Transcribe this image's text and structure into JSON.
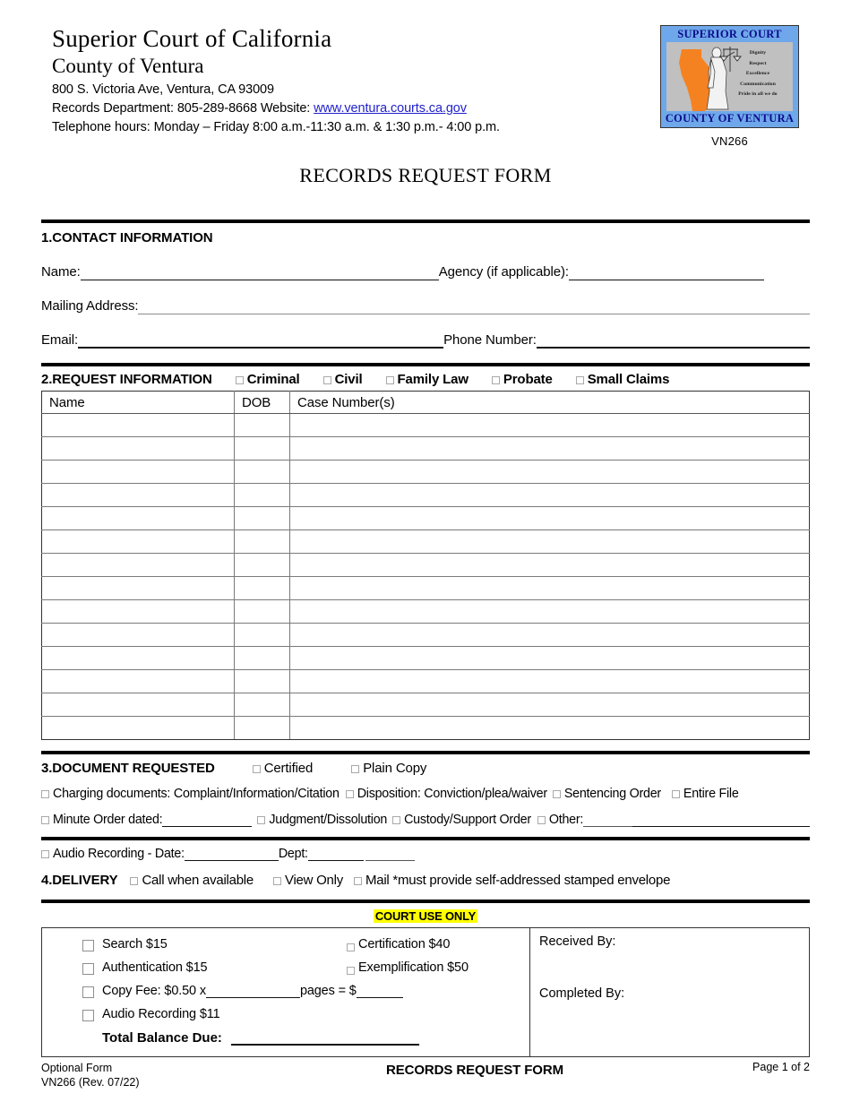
{
  "header": {
    "court_name": "Superior Court of California",
    "county_name": "County of Ventura",
    "address": "800 S. Victoria Ave, Ventura, CA 93009",
    "records_dept_prefix": "Records Department: 805-289-8668  Website: ",
    "website": "www.ventura.courts.ca.gov",
    "telephone_hours": "Telephone hours: Monday – Friday 8:00 a.m.-11:30 a.m. & 1:30 p.m.- 4:00 p.m.",
    "form_code": "VN266"
  },
  "logo": {
    "title": "SUPERIOR COURT",
    "footer": "COUNTY OF VENTURA",
    "values": [
      "Dignity",
      "Respect",
      "Excellence",
      "Communication",
      "Pride in all  we do"
    ],
    "bg_color": "#6fa8ea",
    "inner_color": "#c0c0c0",
    "state_color": "#f58220",
    "text_color": "#0c0c8c"
  },
  "form_title": "RECORDS REQUEST FORM",
  "section1": {
    "heading": "1.CONTACT INFORMATION",
    "name_label": "Name:",
    "agency_label": " Agency (if applicable):",
    "mailing_label": "Mailing Address:",
    "email_label": "Email:",
    "phone_label": "Phone Number:"
  },
  "section2": {
    "heading": "2.REQUEST INFORMATION",
    "categories": [
      "Criminal",
      "Civil",
      "Family Law",
      "Probate",
      "Small Claims"
    ],
    "columns": [
      "Name",
      "DOB",
      "Case Number(s)"
    ],
    "row_count": 14
  },
  "section3": {
    "heading": "3.DOCUMENT REQUESTED",
    "copy_types": [
      "Certified",
      "Plain Copy"
    ],
    "line1": [
      "Charging documents: Complaint/Information/Citation",
      "Disposition: Conviction/plea/waiver",
      "Sentencing Order",
      "Entire File"
    ],
    "minute_order_label": "Minute Order dated:",
    "line2_rest": [
      "Judgment/Dissolution",
      "Custody/Support Order"
    ],
    "other_label": "Other:",
    "audio_label": "Audio Recording - Date:",
    "audio_dept_label": "Dept:"
  },
  "section4": {
    "heading": "4.DELIVERY",
    "options": [
      "Call when available",
      "View Only",
      "Mail *must provide self-addressed stamped envelope"
    ]
  },
  "court_use": {
    "banner": "COURT USE ONLY",
    "banner_highlight": "#ffff00",
    "fees_col1": [
      "Search  $15",
      "Authentication  $15"
    ],
    "copy_fee_prefix": "Copy Fee: $0.50 x",
    "copy_fee_mid": "pages =  $",
    "audio_fee": "Audio Recording  $11",
    "fees_col2": [
      "Certification  $40",
      "Exemplification $50"
    ],
    "total_label": "Total Balance Due:",
    "received_by": "Received By:",
    "completed_by": "Completed By:"
  },
  "footer": {
    "optional_form": "Optional Form",
    "revision": "VN266 (Rev. 07/22)",
    "center_title": "RECORDS REQUEST FORM",
    "page": "Page 1 of 2"
  }
}
